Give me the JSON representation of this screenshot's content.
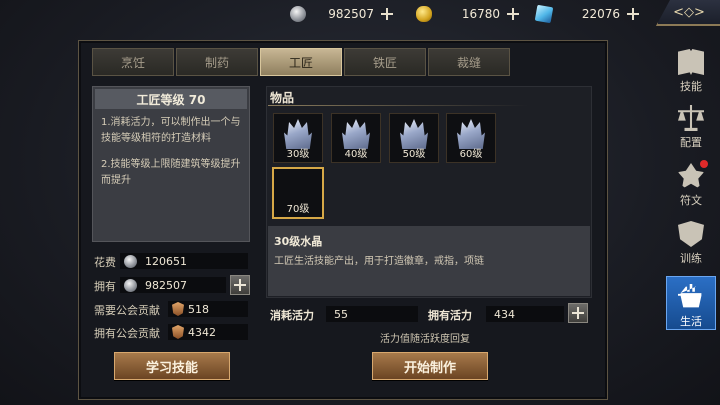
{
  "resources": {
    "silver": "982507",
    "gold": "16780",
    "diamond": "22076"
  },
  "top_back_glyph": "<◇>",
  "tabs": [
    "烹饪",
    "制药",
    "工匠",
    "铁匠",
    "裁缝"
  ],
  "active_tab": "工匠",
  "info": {
    "title": "工匠等级 70",
    "para1": "1.消耗活力，可以制作出一个与技能等级相符的打造材料",
    "para2": "2.技能等级上限随建筑等级提升而提升"
  },
  "stats": {
    "cost_label": "花费",
    "cost_value": "120651",
    "own_label": "拥有",
    "own_value": "982507",
    "guild_req_label": "需要公会贡献",
    "guild_req_value": "518",
    "guild_own_label": "拥有公会贡献",
    "guild_own_value": "4342"
  },
  "learn_button": "学习技能",
  "items": {
    "title": "物品",
    "slots": [
      {
        "label": "30级",
        "has_item": true
      },
      {
        "label": "40级",
        "has_item": true
      },
      {
        "label": "50级",
        "has_item": true
      },
      {
        "label": "60级",
        "has_item": true
      },
      {
        "label": "70级",
        "has_item": false
      }
    ],
    "desc_title": "30级水晶",
    "desc_text": "工匠生活技能产出，用于打造徽章，戒指，项链"
  },
  "vitality": {
    "consume_label": "消耗活力",
    "consume_value": "55",
    "own_label": "拥有活力",
    "own_value": "434",
    "note": "活力值随活跃度回复"
  },
  "start_button": "开始制作",
  "sidebar": {
    "items": [
      {
        "label": "技能",
        "icon": "book-icon"
      },
      {
        "label": "配置",
        "icon": "scale-icon"
      },
      {
        "label": "符文",
        "icon": "rune-icon"
      },
      {
        "label": "训练",
        "icon": "shield-icon"
      },
      {
        "label": "生活",
        "icon": "cooking-pot-icon"
      }
    ],
    "active": "生活"
  },
  "colors": {
    "accent_gold": "#d6a847",
    "button_brown": "#8f5e33",
    "active_blue": "#2b6fc5"
  }
}
